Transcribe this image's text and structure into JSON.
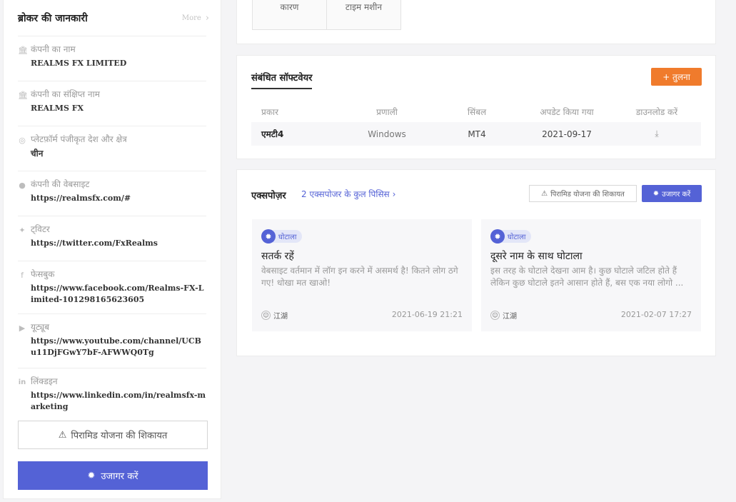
{
  "sidebar": {
    "title": "ब्रोकर की जानकारी",
    "more_label": "More",
    "items": [
      {
        "icon": "bank-icon",
        "label": "कंपनी का नाम",
        "value": "REALMS FX LIMITED"
      },
      {
        "icon": "bank-icon",
        "label": "कंपनी का संक्षिप्त नाम",
        "value": "REALMS FX"
      },
      {
        "icon": "globe-icon",
        "label": "प्लेटफ़ॉर्म पंजीकृत देश और क्षेत्र",
        "value": "चीन"
      },
      {
        "icon": "web-icon",
        "label": "कंपनी की वेबसाइट",
        "value": "https://realmsfx.com/#"
      },
      {
        "icon": "twitter-icon",
        "label": "ट्विटर",
        "value": "https://twitter.com/FxRealms"
      },
      {
        "icon": "facebook-icon",
        "label": "फेसबुक",
        "value": "https://www.facebook.com/Realms-FX-Limited-101298165623605"
      },
      {
        "icon": "youtube-icon",
        "label": "यूट्यूब",
        "value": "https://www.youtube.com/channel/UCBu11DjFGwY7bF-AFWWQ0Tg"
      },
      {
        "icon": "linkedin-icon",
        "label": "लिंक्डइन",
        "value": "https://www.linkedin.com/in/realmsfx-marketing"
      }
    ],
    "complaint_button": "पिरामिड योजना की शिकायत",
    "expose_button": "उजागर करें"
  },
  "top_tabs": [
    "कारण",
    "टाइम मशीन"
  ],
  "software": {
    "title": "संबंधित सॉफ्टवेयर",
    "compare_button": "+ तुलना",
    "headers": [
      "प्रकार",
      "प्रणाली",
      "सिंबल",
      "अपडेट किया गया",
      "डाउनलोड करें"
    ],
    "rows": [
      {
        "type": "एमटी4",
        "system": "Windows",
        "symbol": "MT4",
        "updated": "2021-09-17"
      }
    ]
  },
  "exposure": {
    "title": "एक्सपोज़र",
    "count_link": "2 एक्सपोजर के कुल पिसिस",
    "complaint_button": "पिरामिड योजना की शिकायत",
    "expose_button": "उजागर करें",
    "cards": [
      {
        "badge": "घोटाला",
        "title": "सतर्क रहें",
        "text": "वेबसाइट वर्तमान में लॉग इन करने में असमर्थ है! कितने लोग ठगे गए! धोखा मत खाओ!",
        "user": "江湖",
        "date": "2021-06-19 21:21"
      },
      {
        "badge": "घोटाला",
        "title": "दूसरे नाम के साथ घोटाला",
        "text": "इस तरह के घोटाले देखना आम है। कुछ घोटाले जटिल होते हैं लेकिन कुछ घोटाले इतने आसान होते हैं, बस एक नया लोगो ...",
        "user": "江湖",
        "date": "2021-02-07 17:27"
      }
    ]
  }
}
